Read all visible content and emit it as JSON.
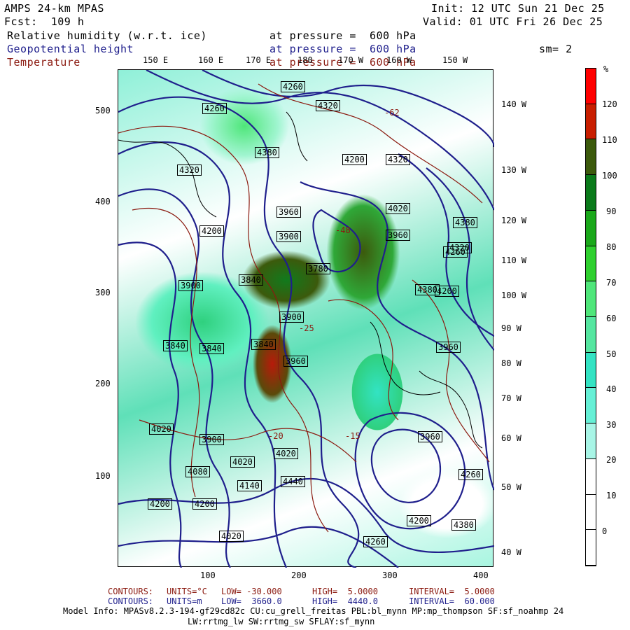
{
  "header": {
    "model": "AMPS 24-km MPAS",
    "init": "Init: 12 UTC Sun 21 Dec 25",
    "fcst": "Fcst:  109 h",
    "valid": "Valid: 01 UTC Fri 26 Dec 25"
  },
  "fields": [
    {
      "name": "Relative humidity (w.r.t. ice)",
      "level": "at pressure =  600 hPa",
      "color": "#000000"
    },
    {
      "name": "Geopotential height",
      "level": "at pressure =  600 hPa",
      "color": "#1f1f8c"
    },
    {
      "name": "Temperature",
      "level": "at pressure =  600 hPa",
      "color": "#8b1a10"
    }
  ],
  "smoothing": "sm= 2",
  "top_lon_labels": [
    "150 E",
    "160 E",
    "170 E",
    "180",
    "170 W",
    "160 W",
    "150 W"
  ],
  "right_lon_labels": [
    "140 W",
    "130 W",
    "120 W",
    "110 W",
    "100 W",
    "90 W",
    "80 W",
    "70 W",
    "60 W",
    "50 W",
    "40 W"
  ],
  "y_ticks": [
    "500",
    "400",
    "300",
    "200",
    "100"
  ],
  "x_ticks": [
    "100",
    "200",
    "300",
    "400"
  ],
  "height_labels": [
    "4260",
    "4260",
    "4320",
    "4380",
    "4320",
    "4200",
    "4320",
    "4020",
    "4380",
    "4200",
    "3960",
    "3900",
    "3960",
    "4320",
    "3900",
    "3780",
    "4200",
    "3840",
    "3900",
    "3840",
    "3960",
    "3840",
    "3840",
    "3960",
    "4020",
    "3900",
    "3960",
    "4080",
    "4020",
    "4140",
    "4440",
    "4200",
    "4200",
    "4020",
    "4260",
    "4380",
    "4260",
    "4200",
    "4020",
    "4260",
    "4380"
  ],
  "temp_labels": [
    "-48",
    "-62",
    "-25",
    "-20",
    "-15"
  ],
  "colorbar": {
    "unit": "%",
    "labels": [
      "120",
      "110",
      "100",
      "90",
      "80",
      "70",
      "60",
      "50",
      "40",
      "30",
      "20",
      "10",
      "0"
    ],
    "colors": [
      "#ff0000",
      "#c81e00",
      "#3c5a0c",
      "#0a7a1a",
      "#1aa81a",
      "#2fd02f",
      "#4fe67a",
      "#55e6a0",
      "#33e3c3",
      "#66f0d6",
      "#a8f5e6",
      "#ffffff",
      "#ffffff",
      "#ffffff"
    ]
  },
  "footer": {
    "contours1": {
      "label": "CONTOURS:",
      "units": "UNITS=°C",
      "low": "LOW= -30.000",
      "high": "HIGH=  5.0000",
      "interval": "INTERVAL=  5.0000"
    },
    "contours2": {
      "label": "CONTOURS:",
      "units": "UNITS=m",
      "low": "LOW=  3660.0",
      "high": "HIGH=  4440.0",
      "interval": "INTERVAL=  60.000"
    },
    "model_info1": "Model Info: MPASv8.2.3-194-gf29cd82c CU:cu_grell_freitas PBL:bl_mynn MP:mp_thompson SF:sf_noahmp 24",
    "model_info2": "LW:rrtmg_lw SW:rrtmg_sw SFLAY:sf_mynn"
  }
}
